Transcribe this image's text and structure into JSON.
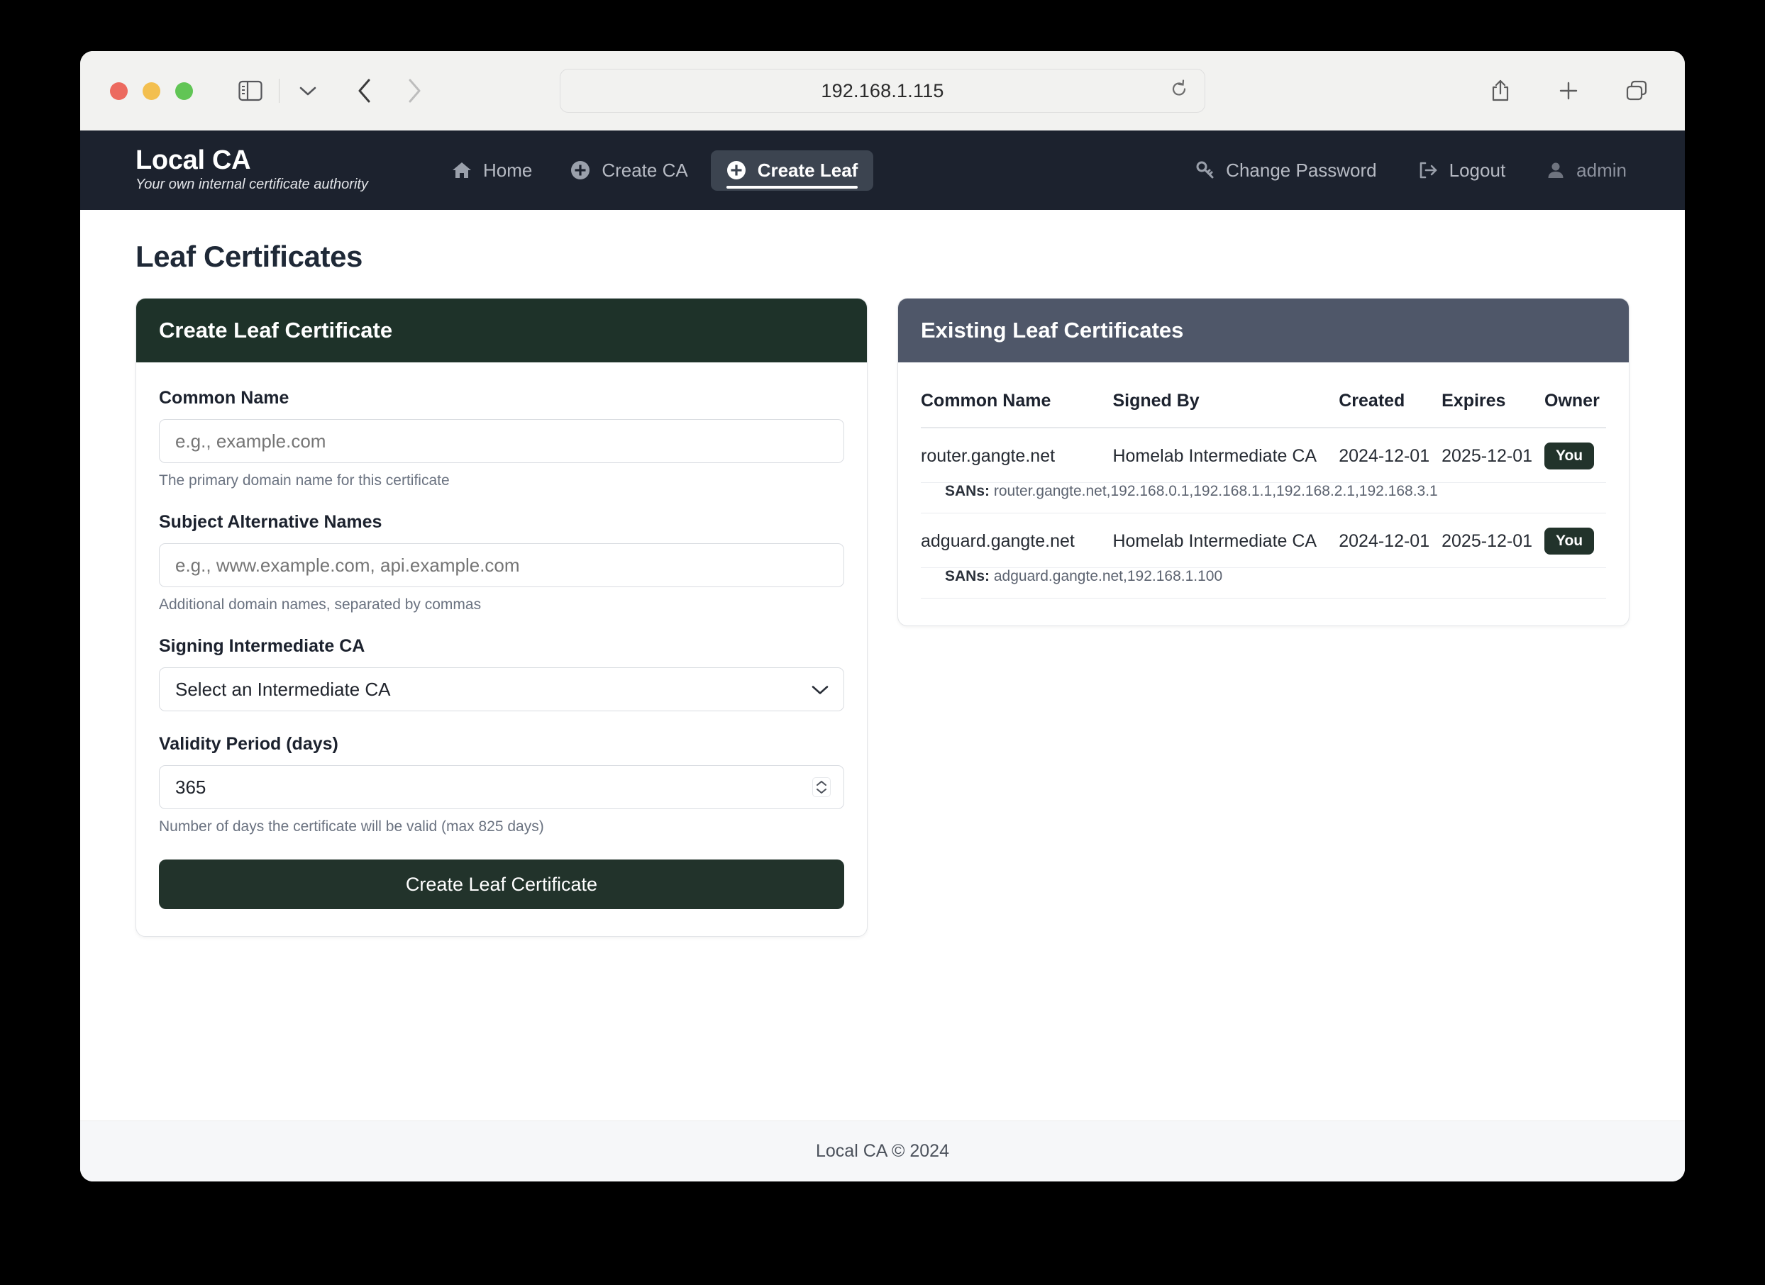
{
  "browser": {
    "url": "192.168.1.115",
    "icons": {
      "sidebar": "sidebar-icon",
      "chevron_down": "chevron-down-icon",
      "back": "back-arrow-icon",
      "forward": "forward-arrow-icon",
      "reload": "reload-icon",
      "share": "share-icon",
      "new_tab": "plus-icon",
      "tab_overview": "tabs-icon"
    }
  },
  "appnav": {
    "brand_title": "Local CA",
    "brand_subtitle": "Your own internal certificate authority",
    "items": [
      {
        "label": "Home",
        "icon": "home-icon",
        "active": false
      },
      {
        "label": "Create CA",
        "icon": "plus-circle-icon",
        "active": false
      },
      {
        "label": "Create Leaf",
        "icon": "plus-circle-icon",
        "active": true
      }
    ],
    "right_items": [
      {
        "label": "Change Password",
        "icon": "key-icon"
      },
      {
        "label": "Logout",
        "icon": "logout-icon"
      },
      {
        "label": "admin",
        "icon": "user-icon"
      }
    ]
  },
  "page": {
    "title": "Leaf Certificates"
  },
  "form": {
    "header": "Create Leaf Certificate",
    "fields": {
      "common_name": {
        "label": "Common Name",
        "placeholder": "e.g., example.com",
        "value": "",
        "help": "The primary domain name for this certificate"
      },
      "sans": {
        "label": "Subject Alternative Names",
        "placeholder": "e.g., www.example.com, api.example.com",
        "value": "",
        "help": "Additional domain names, separated by commas"
      },
      "signing_ca": {
        "label": "Signing Intermediate CA",
        "selected": "Select an Intermediate CA",
        "options": [
          "Select an Intermediate CA"
        ]
      },
      "validity": {
        "label": "Validity Period (days)",
        "value": "365",
        "help": "Number of days the certificate will be valid (max 825 days)"
      }
    },
    "submit_label": "Create Leaf Certificate"
  },
  "existing": {
    "header": "Existing Leaf Certificates",
    "columns": [
      "Common Name",
      "Signed By",
      "Created",
      "Expires",
      "Owner"
    ],
    "san_label": "SANs:",
    "rows": [
      {
        "common_name": "router.gangte.net",
        "signed_by": "Homelab Intermediate CA",
        "created": "2024-12-01",
        "expires": "2025-12-01",
        "owner": "You",
        "sans": "router.gangte.net,192.168.0.1,192.168.1.1,192.168.2.1,192.168.3.1"
      },
      {
        "common_name": "adguard.gangte.net",
        "signed_by": "Homelab Intermediate CA",
        "created": "2024-12-01",
        "expires": "2025-12-01",
        "owner": "You",
        "sans": "adguard.gangte.net,192.168.1.100"
      }
    ]
  },
  "footer": {
    "text": "Local CA © 2024"
  },
  "colors": {
    "nav_bg": "#1c222e",
    "nav_active_bg": "#3c4450",
    "green_header": "#1e3229",
    "slate_header": "#4f5769",
    "button_green": "#22332b",
    "page_bg": "#ffffff",
    "footer_bg": "#f6f7f9"
  }
}
